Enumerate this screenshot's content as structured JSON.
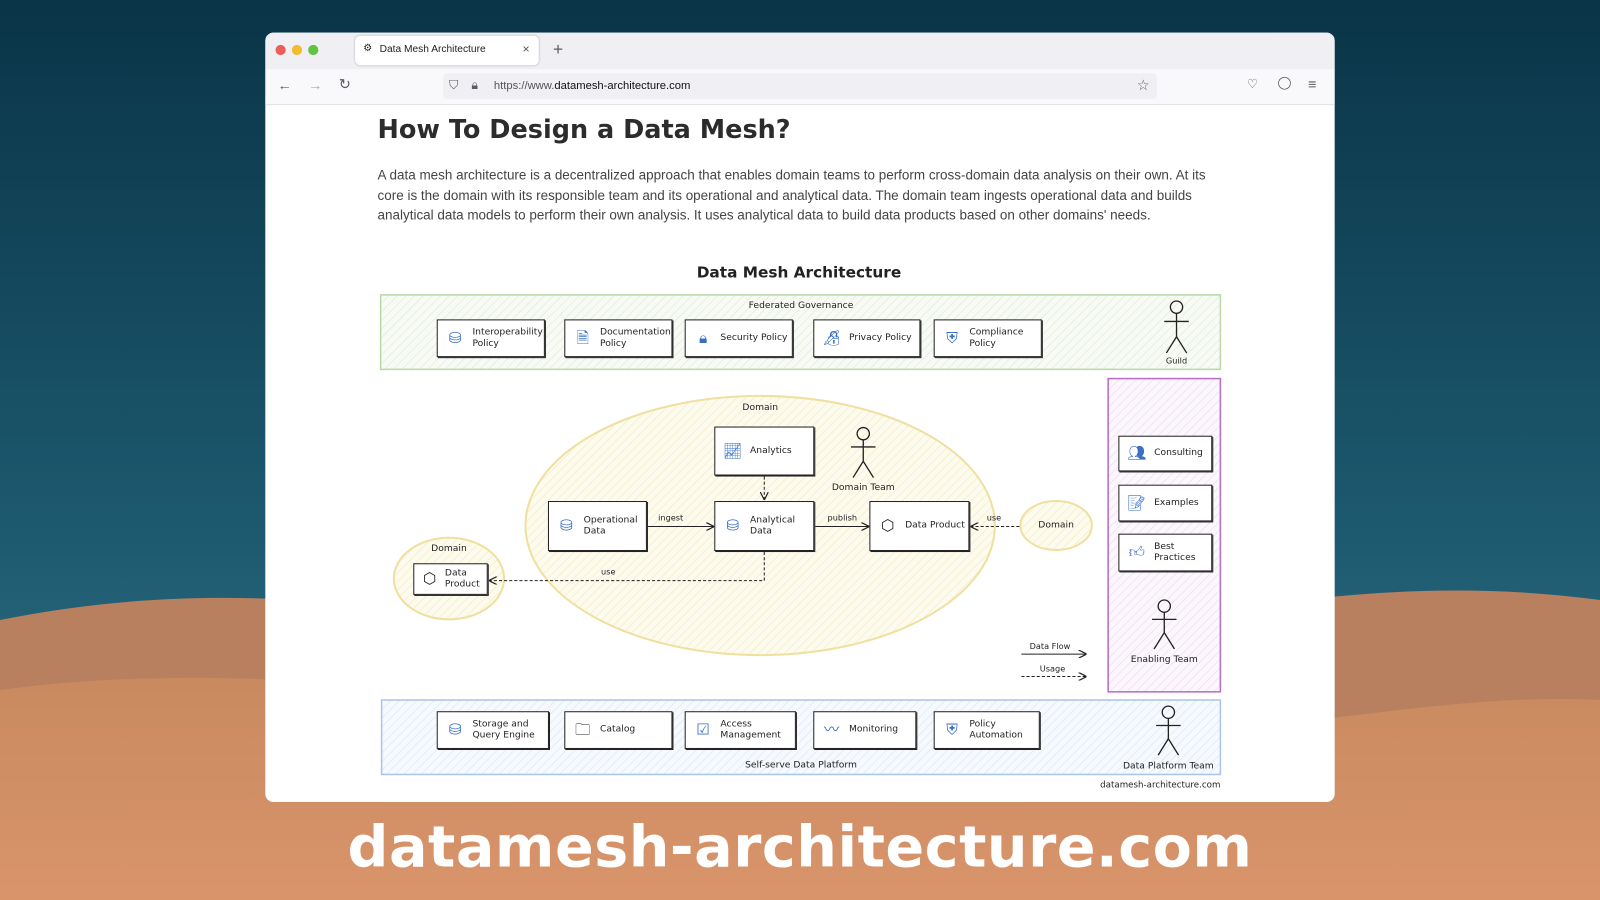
{
  "browser": {
    "tab_title": "Data Mesh Architecture",
    "url_prefix": "https://www.",
    "url_domain": "datamesh-architecture.com",
    "new_tab": "+",
    "close_tab": "×"
  },
  "page": {
    "title": "How To Design a Data Mesh?",
    "paragraph": "A data mesh architecture is a decentralized approach that enables domain teams to perform cross-domain data analysis on their own. At its core is the domain with its responsible team and its operational and analytical data. The domain team ingests operational data and builds analytical data models to perform their own analysis. It uses analytical data to build data products based on other domains' needs."
  },
  "diagram": {
    "title": "Data Mesh Architecture",
    "governance": {
      "label": "Federated Governance",
      "actor": "Guild",
      "policies": [
        {
          "label": "Interoperability Policy",
          "icon": "database-network-icon"
        },
        {
          "label": "Documentation Policy",
          "icon": "document-icon"
        },
        {
          "label": "Security Policy",
          "icon": "lock-icon"
        },
        {
          "label": "Privacy Policy",
          "icon": "privacy-lock-icon"
        },
        {
          "label": "Compliance Policy",
          "icon": "compliance-shield-icon"
        }
      ]
    },
    "domain": {
      "label": "Domain",
      "team": "Domain Team",
      "analytics": "Analytics",
      "operational": "Operational Data",
      "analytical": "Analytical Data",
      "product": "Data Product",
      "ingest": "ingest",
      "publish": "publish",
      "use_right": "use",
      "use_left": "use"
    },
    "other_domain_right": "Domain",
    "other_domain_left": {
      "label": "Domain",
      "product": "Data Product"
    },
    "enabling": {
      "actor": "Enabling Team",
      "items": [
        {
          "label": "Consulting",
          "icon": "people-chat-icon"
        },
        {
          "label": "Examples",
          "icon": "notes-icon"
        },
        {
          "label": "Best Practices",
          "icon": "thumbs-up-icon"
        }
      ]
    },
    "legend": {
      "flow": "Data Flow",
      "usage": "Usage"
    },
    "platform": {
      "label": "Self-serve Data Platform",
      "actor": "Data Platform Team",
      "items": [
        {
          "label": "Storage and Query Engine",
          "icon": "database-icon"
        },
        {
          "label": "Catalog",
          "icon": "folder-icon"
        },
        {
          "label": "Access Management",
          "icon": "hand-check-icon"
        },
        {
          "label": "Monitoring",
          "icon": "pulse-icon"
        },
        {
          "label": "Policy Automation",
          "icon": "robot-shield-icon"
        }
      ]
    },
    "credit": "datamesh-architecture.com"
  },
  "banner": "datamesh-architecture.com",
  "colors": {
    "governance": "#b7d9a8",
    "enabling": "#b86cc7",
    "platform": "#a9c6e8",
    "domain": "#f3e7a6"
  }
}
